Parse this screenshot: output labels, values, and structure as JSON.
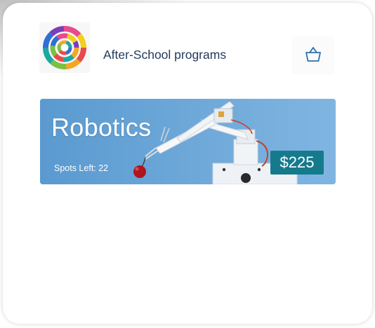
{
  "header": {
    "title": "After-School programs",
    "logo_icon": "concentric-rings-logo",
    "cart_icon": "basket-icon"
  },
  "programs": [
    {
      "name": "Robotics",
      "spots_left": "Spots Left: 22",
      "price": "$225",
      "image": "robotic-arm-holding-cherry"
    }
  ],
  "colors": {
    "title_text": "#1f3a5c",
    "price_badge": "#157a8c",
    "card_background": "#6ea8da",
    "basket_icon": "#2a6fb0"
  }
}
